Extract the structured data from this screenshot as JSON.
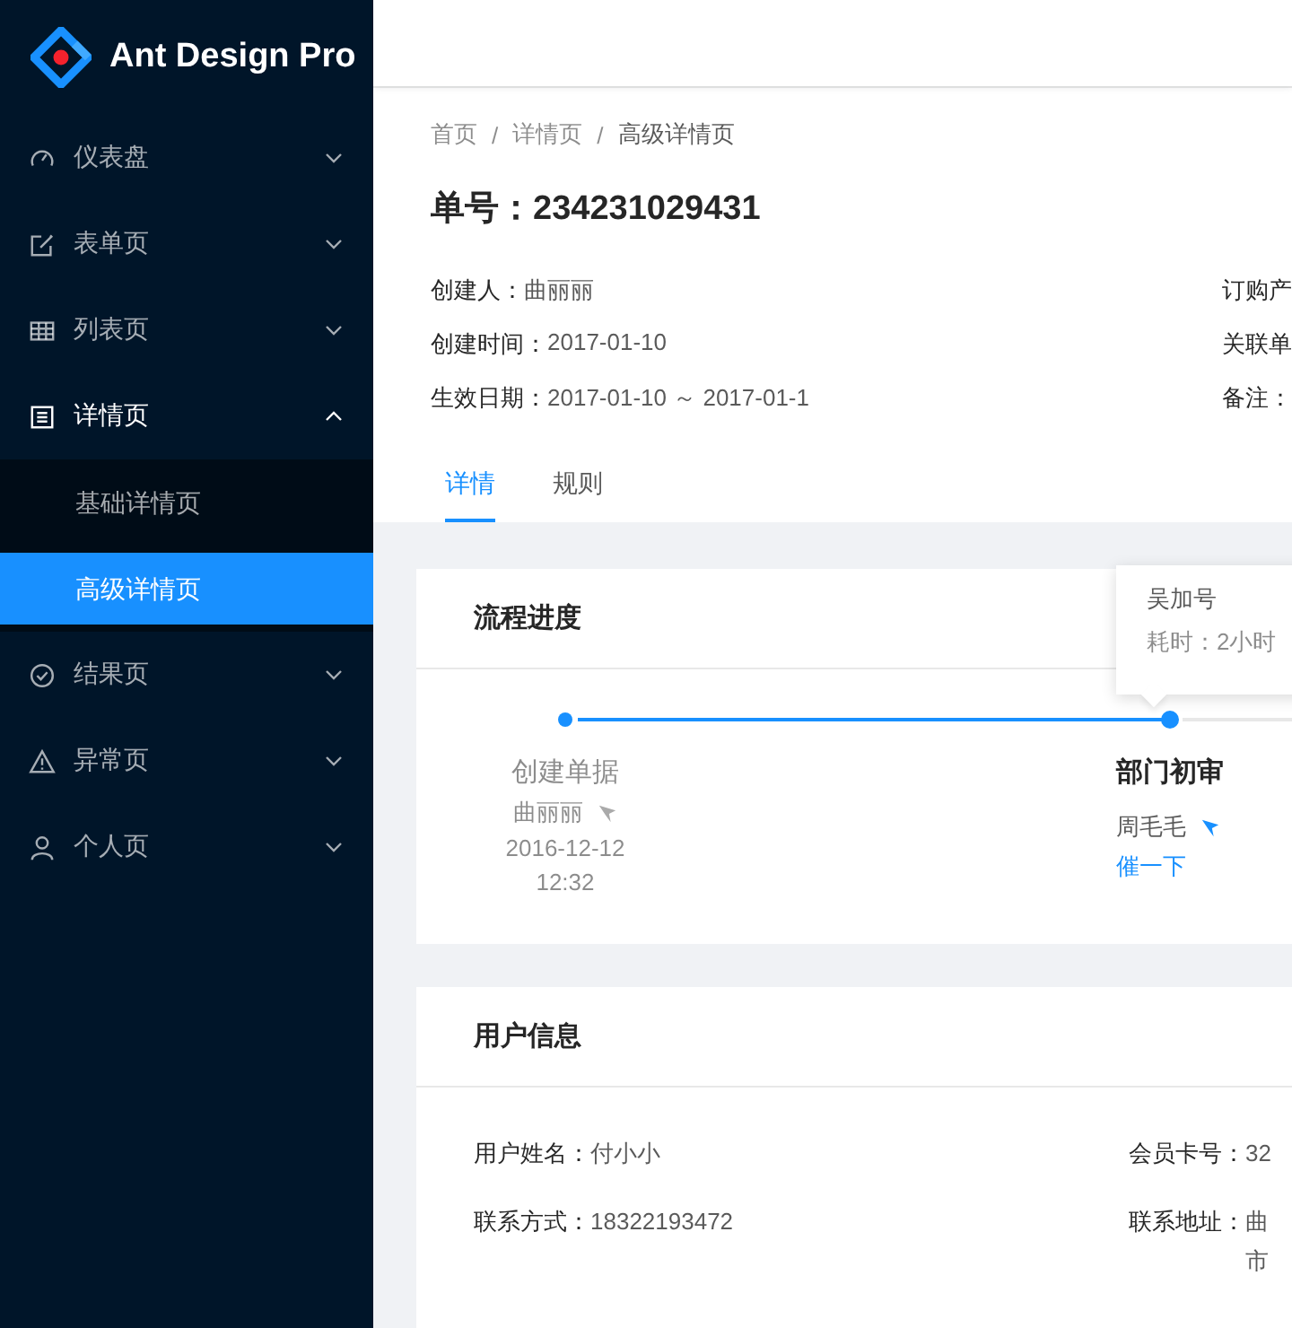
{
  "sidebar": {
    "logo": "Ant Design Pro",
    "items": [
      {
        "label": "仪表盘",
        "selected": false,
        "expanded": false
      },
      {
        "label": "表单页",
        "selected": false,
        "expanded": false
      },
      {
        "label": "列表页",
        "selected": false,
        "expanded": false
      },
      {
        "label": "详情页",
        "selected": true,
        "expanded": true,
        "children": [
          {
            "label": "基础详情页",
            "selected": false
          },
          {
            "label": "高级详情页",
            "selected": true
          }
        ]
      },
      {
        "label": "结果页",
        "selected": false,
        "expanded": false
      },
      {
        "label": "异常页",
        "selected": false,
        "expanded": false
      },
      {
        "label": "个人页",
        "selected": false,
        "expanded": false
      }
    ]
  },
  "breadcrumb": [
    {
      "label": "首页",
      "separator": "/"
    },
    {
      "label": "详情页",
      "separator": "/"
    },
    {
      "label": "高级详情页"
    }
  ],
  "title": "单号：234231029431",
  "descriptions": [
    {
      "label": "创建人：",
      "value": "曲丽丽",
      "right": "订购产"
    },
    {
      "label": "创建时间：",
      "value": "2017-01-10",
      "right": "关联单"
    },
    {
      "label": "生效日期：",
      "value": "2017-01-10 ～ 2017-01-1",
      "right": "备注："
    }
  ],
  "tabs": [
    {
      "label": "详情",
      "selected": true
    },
    {
      "label": "规则",
      "selected": false
    }
  ],
  "progress": {
    "title": "流程进度",
    "steps": [
      {
        "title": "创建单据",
        "person": "曲丽丽",
        "time": "2016-12-12 12:32",
        "current": false
      },
      {
        "title": "部门初审",
        "person": "周毛毛",
        "action": "催一下",
        "current": true
      }
    ],
    "tooltip": {
      "name": "吴加号",
      "duration": "耗时：2小时"
    }
  },
  "user_info": {
    "title": "用户信息",
    "left": [
      {
        "label": "用户姓名：",
        "value": "付小小"
      },
      {
        "label": "联系方式：",
        "value": "18322193472"
      }
    ],
    "right": [
      {
        "label": "会员卡号：",
        "value": "32"
      },
      {
        "label": "联系地址：",
        "value": "曲",
        "value_line2": "市"
      }
    ]
  }
}
